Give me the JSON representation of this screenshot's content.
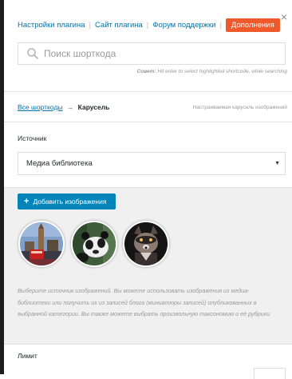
{
  "nav": {
    "settings": "Настройки плагина",
    "site": "Сайт плагина",
    "forum": "Форум поддержки",
    "addons": "Дополнения",
    "close": "×"
  },
  "search": {
    "placeholder": "Поиск шорткода",
    "hint_label": "Совет:",
    "hint_text": "Hit enter to select highlighted shortcode, while searching"
  },
  "breadcrumb": {
    "all": "Все шорткоды",
    "arrow": "→",
    "current": "Карусель",
    "description": "Настраиваемая карусель изображений"
  },
  "source": {
    "label": "Источник",
    "value": "Медиа библиотека"
  },
  "images": {
    "add_label": "Добавить изображения",
    "thumbnails": [
      "london-photo",
      "panda-photo",
      "raccoon-photo"
    ]
  },
  "help_text": "Выберите источник изображений. Вы можете использовать изображения из медиа-библиотеки или получить их из записей блога (миниатюры записей) опубликованных в выбранной категории. Вы также можете выбрать произвольную таксономию и её рубрики",
  "limit": {
    "label": "Лимит"
  },
  "colors": {
    "link": "#0073aa",
    "addon_badge": "#f0592a",
    "button": "#0085ba"
  }
}
